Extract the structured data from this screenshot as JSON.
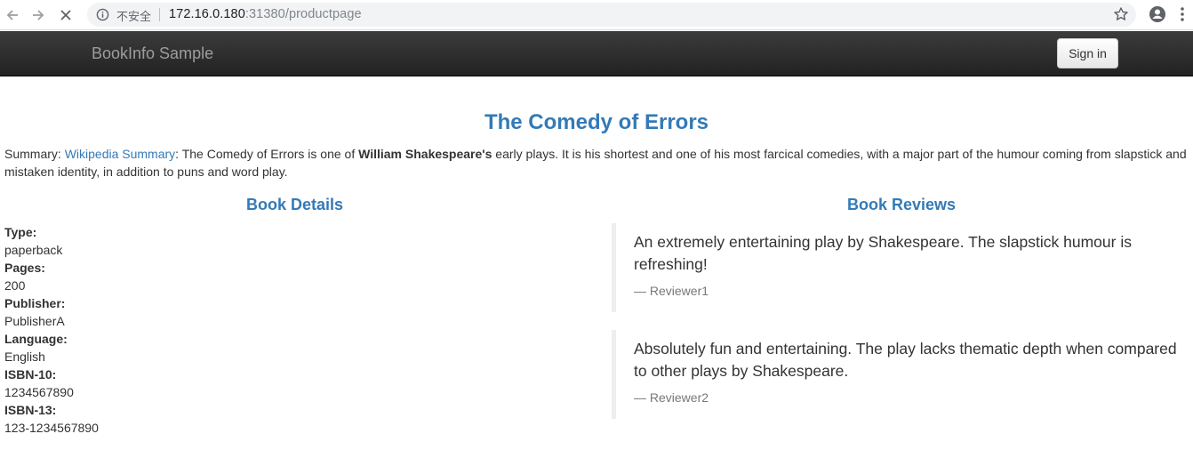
{
  "browser": {
    "insecure_label": "不安全",
    "url_host": "172.16.0.180",
    "url_rest": ":31380/productpage"
  },
  "navbar": {
    "brand": "BookInfo Sample",
    "signin_label": "Sign in"
  },
  "book": {
    "title": "The Comedy of Errors",
    "summary_label": "Summary: ",
    "summary_link": "Wikipedia Summary",
    "summary_pre": ": The Comedy of Errors is one of ",
    "summary_bold": "William Shakespeare's",
    "summary_post": " early plays. It is his shortest and one of his most farcical comedies, with a major part of the humour coming from slapstick and mistaken identity, in addition to puns and word play."
  },
  "details": {
    "heading": "Book Details",
    "items": [
      {
        "label": "Type:",
        "value": "paperback"
      },
      {
        "label": "Pages:",
        "value": "200"
      },
      {
        "label": "Publisher:",
        "value": "PublisherA"
      },
      {
        "label": "Language:",
        "value": "English"
      },
      {
        "label": "ISBN-10:",
        "value": "1234567890"
      },
      {
        "label": "ISBN-13:",
        "value": "123-1234567890"
      }
    ]
  },
  "reviews": {
    "heading": "Book Reviews",
    "items": [
      {
        "text": "An extremely entertaining play by Shakespeare. The slapstick humour is refreshing!",
        "author": "— Reviewer1"
      },
      {
        "text": "Absolutely fun and entertaining. The play lacks thematic depth when compared to other plays by Shakespeare.",
        "author": "— Reviewer2"
      }
    ]
  }
}
